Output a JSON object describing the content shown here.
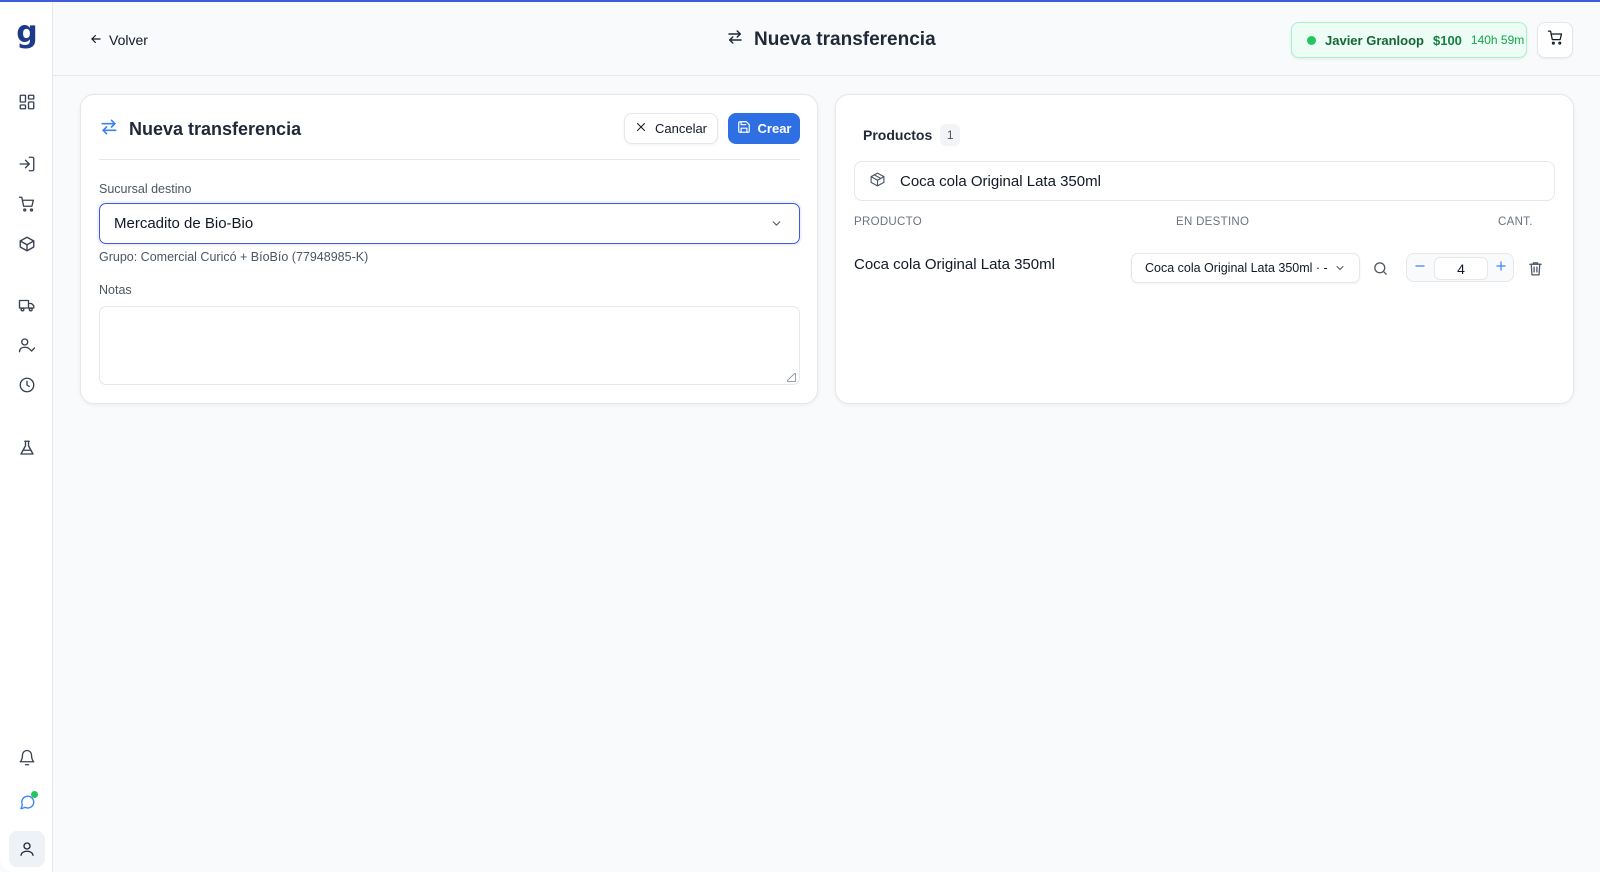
{
  "app": {
    "logo": "g"
  },
  "header": {
    "back_label": "Volver",
    "title": "Nueva transferencia",
    "session": {
      "name": "Javier Granloop",
      "amount": "$100",
      "time": "140h 59m",
      "status_color": "#22c55e"
    }
  },
  "sidebar": {
    "items": [
      {
        "icon": "dashboard-icon"
      },
      {
        "icon": "login-icon"
      },
      {
        "icon": "cart-icon"
      },
      {
        "icon": "package-icon"
      },
      {
        "icon": "truck-icon"
      },
      {
        "icon": "user-check-icon"
      },
      {
        "icon": "clock-icon"
      },
      {
        "icon": "flask-icon"
      }
    ],
    "bottom": [
      {
        "icon": "bell-icon"
      },
      {
        "icon": "chat-icon"
      },
      {
        "icon": "user-icon"
      }
    ]
  },
  "form": {
    "title": "Nueva transferencia",
    "cancel_label": "Cancelar",
    "create_label": "Crear",
    "destination_label": "Sucursal destino",
    "destination_value": "Mercadito de Bio-Bio",
    "group_text": "Grupo: Comercial Curicó + BíoBío (77948985-K)",
    "notes_label": "Notas",
    "notes_value": ""
  },
  "products": {
    "title": "Productos",
    "count": "1",
    "search_value": "Coca cola Original Lata 350ml",
    "columns": [
      "PRODUCTO",
      "EN DESTINO",
      "CANT."
    ],
    "rows": [
      {
        "name": "Coca cola Original Lata 350ml",
        "destination": "Coca cola Original Lata 350ml · -",
        "quantity": "4"
      }
    ]
  },
  "colors": {
    "accent": "#2f6fe4",
    "focus_border": "#3b5bdb",
    "session_bg": "#ecfdf5"
  }
}
